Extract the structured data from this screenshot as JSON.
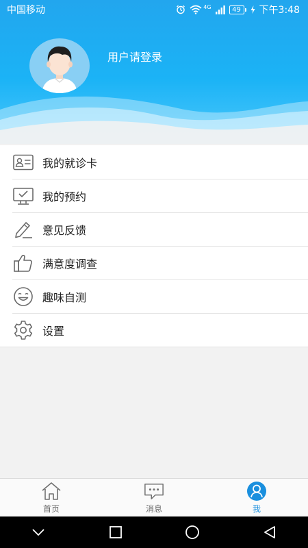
{
  "status_bar": {
    "carrier": "中国移动",
    "network_badge": "4G",
    "battery": "49",
    "time": "下午3:48"
  },
  "profile": {
    "login_prompt": "用户请登录",
    "avatar_icon": "default-avatar-icon"
  },
  "menu": {
    "items": [
      {
        "label": "我的就诊卡",
        "icon": "id-card-icon"
      },
      {
        "label": "我的预约",
        "icon": "monitor-check-icon"
      },
      {
        "label": "意见反馈",
        "icon": "pencil-edit-icon"
      },
      {
        "label": "满意度调查",
        "icon": "thumbs-up-icon"
      },
      {
        "label": "趣味自测",
        "icon": "smiley-face-icon"
      },
      {
        "label": "设置",
        "icon": "gear-icon"
      }
    ]
  },
  "tabbar": {
    "tabs": [
      {
        "label": "首页",
        "icon": "home-icon",
        "active": false
      },
      {
        "label": "消息",
        "icon": "message-bubble-icon",
        "active": false
      },
      {
        "label": "我",
        "icon": "person-icon",
        "active": true
      }
    ]
  },
  "colors": {
    "header_blue": "#1bb3f6",
    "accent": "#1a8fde",
    "icon_gray": "#666666"
  }
}
